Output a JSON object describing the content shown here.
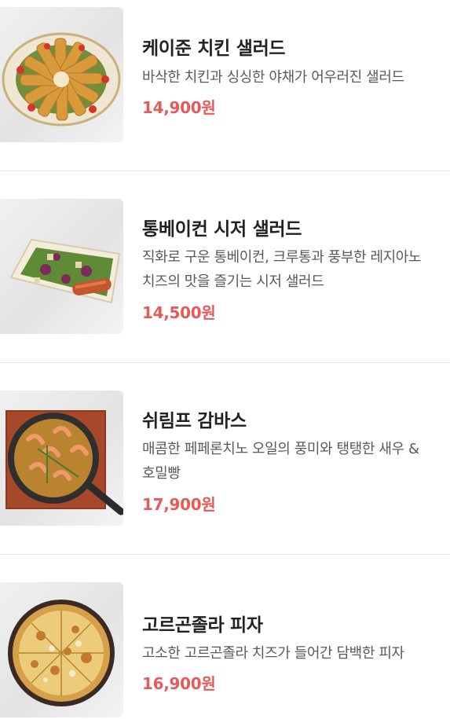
{
  "menu_items": [
    {
      "title": "케이준 치킨 샐러드",
      "desc_lines": [
        "바삭한 치킨과 싱싱한 야채가 어우러진 샐러드"
      ],
      "price": "14,900원",
      "image_icon": "cajun-chicken-salad-image"
    },
    {
      "title": "통베이컨 시저 샐러드",
      "desc_lines": [
        "직화로 구운 통베이컨, 크루통과 풍부한 레지아노",
        "치즈의 맛을 즐기는 시저 샐러드"
      ],
      "price": "14,500원",
      "image_icon": "bacon-caesar-salad-image"
    },
    {
      "title": "쉬림프 감바스",
      "desc_lines": [
        "매콤한 페페론치노 오일의 풍미와 탱탱한 새우 &",
        "호밀빵"
      ],
      "price": "17,900원",
      "image_icon": "shrimp-gambas-image"
    },
    {
      "title": "고르곤졸라 피자",
      "desc_lines": [
        "고소한 고르곤졸라 치즈가 들어간 담백한 피자"
      ],
      "price": "16,900원",
      "image_icon": "gorgonzola-pizza-image"
    }
  ],
  "colors": {
    "price": "#e75a5a",
    "title": "#222222",
    "description": "#5a5a5a",
    "divider": "#e9e9e9"
  }
}
